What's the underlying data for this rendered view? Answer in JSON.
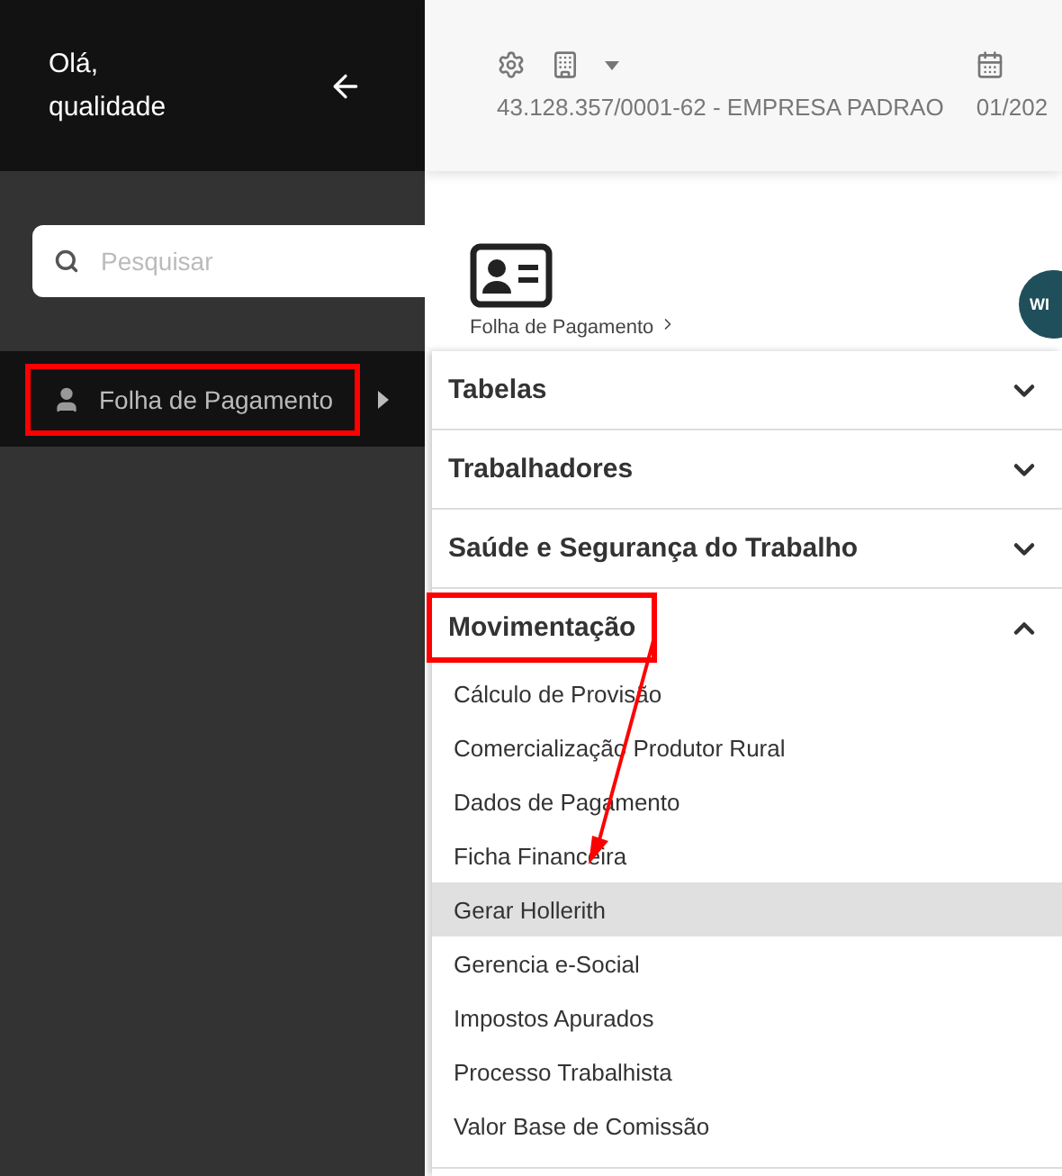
{
  "sidebar": {
    "greeting": "Olá,",
    "user": "qualidade",
    "search": {
      "placeholder": "Pesquisar"
    },
    "items": [
      {
        "label": "Folha de Pagamento",
        "highlighted": true
      }
    ]
  },
  "header": {
    "company": "43.128.357/0001-62 - EMPRESA PADRAO",
    "period": "01/202"
  },
  "module": {
    "label": "Folha de Pagamento",
    "badge": "WI"
  },
  "menu": [
    {
      "label": "Tabelas",
      "expanded": false,
      "highlighted": false
    },
    {
      "label": "Trabalhadores",
      "expanded": false,
      "highlighted": false
    },
    {
      "label": "Saúde e Segurança do Trabalho",
      "expanded": false,
      "highlighted": false
    },
    {
      "label": "Movimentação",
      "expanded": true,
      "highlighted": true,
      "children": [
        {
          "label": "Cálculo de Provisão",
          "selected": false
        },
        {
          "label": "Comercialização Produtor Rural",
          "selected": false
        },
        {
          "label": "Dados de Pagamento",
          "selected": false
        },
        {
          "label": "Ficha Financeira",
          "selected": false
        },
        {
          "label": "Gerar Hollerith",
          "selected": true
        },
        {
          "label": "Gerencia e-Social",
          "selected": false
        },
        {
          "label": "Impostos Apurados",
          "selected": false
        },
        {
          "label": "Processo Trabalhista",
          "selected": false
        },
        {
          "label": "Valor Base de Comissão",
          "selected": false
        }
      ]
    }
  ]
}
